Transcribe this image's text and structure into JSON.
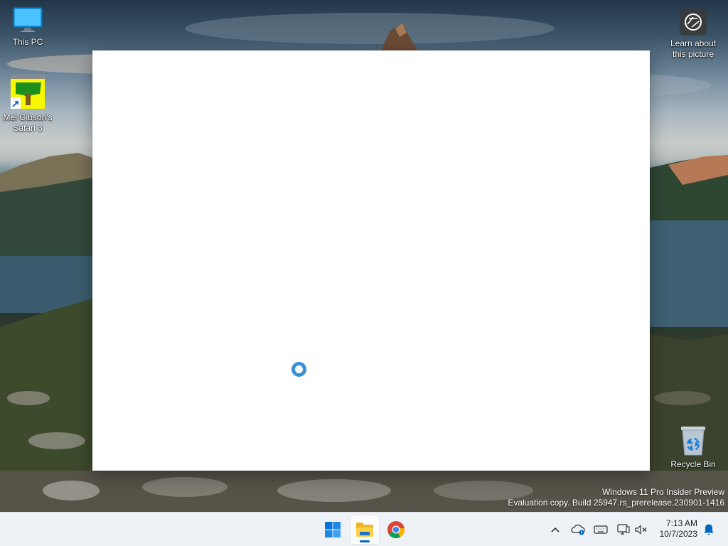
{
  "desktop": {
    "icons": [
      {
        "label": "This PC",
        "icon": "monitor-icon"
      },
      {
        "label": "Mel Gibson's Safari 3",
        "icon": "app-shortcut-icon"
      },
      {
        "label": "Learn about this picture",
        "icon": "camera-icon"
      },
      {
        "label": "Recycle Bin",
        "icon": "recycle-bin-icon"
      }
    ]
  },
  "window": {
    "state": "loading",
    "spinner_color": "#3b8fd9",
    "background": "#ffffff"
  },
  "watermark": {
    "line1": "Windows 11 Pro Insider Preview",
    "line2": "Evaluation copy. Build 25947.rs_prerelease.230901-1416"
  },
  "taskbar": {
    "apps": [
      {
        "name": "Start",
        "icon": "windows-logo-icon",
        "active": false
      },
      {
        "name": "File Explorer",
        "icon": "folder-icon",
        "active": true
      },
      {
        "name": "Google Chrome",
        "icon": "chrome-icon",
        "active": false
      }
    ],
    "tray": [
      {
        "name": "Show hidden icons",
        "icon": "chevron-up-icon"
      },
      {
        "name": "OneDrive",
        "icon": "cloud-icon"
      },
      {
        "name": "Keyboard",
        "icon": "keyboard-icon"
      },
      {
        "name": "Network",
        "icon": "network-icon"
      },
      {
        "name": "Volume",
        "icon": "speaker-muted-icon"
      }
    ],
    "clock": {
      "time": "7:13 AM",
      "date": "10/7/2023"
    },
    "notification_icon": "bell-icon",
    "accent": "#0067c0"
  }
}
